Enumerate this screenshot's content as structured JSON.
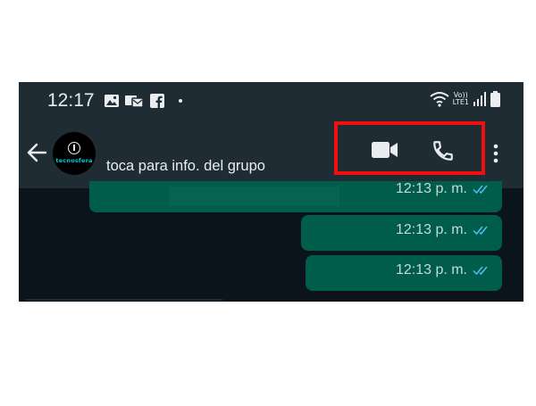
{
  "status_bar": {
    "time": "12:17",
    "volte_top": "Vo))",
    "volte_bottom": "LTE1",
    "icons": [
      "gallery-icon",
      "message-icon",
      "facebook-icon",
      "wifi-icon",
      "signal-icon",
      "battery-icon"
    ]
  },
  "header": {
    "avatar_text": "tecnosfera",
    "subtitle": "toca para info. del grupo",
    "icons": [
      "back-arrow-icon",
      "video-call-icon",
      "voice-call-icon",
      "more-options-icon"
    ],
    "highlight_color": "#f10f0f"
  },
  "messages": [
    {
      "time": "12:13 p. m."
    },
    {
      "time": "12:13 p. m."
    },
    {
      "time": "12:13 p. m."
    }
  ],
  "colors": {
    "bar": "#1f2c34",
    "background": "#0b141a",
    "outgoing_bubble": "#005c4b",
    "read_ticks": "#53bdeb"
  }
}
